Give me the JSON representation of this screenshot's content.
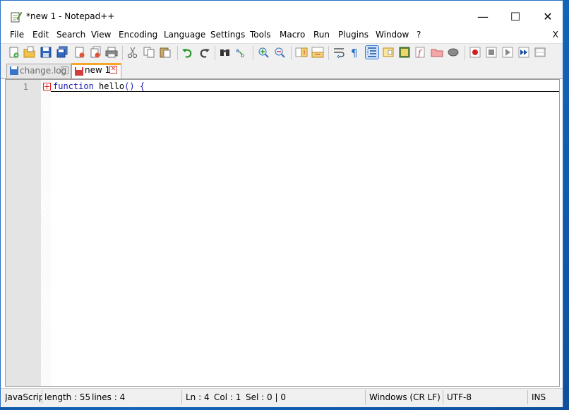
{
  "window": {
    "title": "*new 1 - Notepad++"
  },
  "window_buttons": {
    "minimize": "—",
    "maximize": "☐",
    "close": "✕"
  },
  "menu": {
    "items": [
      "File",
      "Edit",
      "Search",
      "View",
      "Encoding",
      "Language",
      "Settings",
      "Tools",
      "Macro",
      "Run",
      "Plugins",
      "Window",
      "?"
    ],
    "close_doc": "X"
  },
  "toolbar": {
    "icons": [
      "new-file-icon",
      "open-file-icon",
      "save-icon",
      "save-all-icon",
      "close-icon",
      "close-all-icon",
      "print-icon",
      "cut-icon",
      "copy-icon",
      "paste-icon",
      "undo-icon",
      "redo-icon",
      "find-icon",
      "replace-icon",
      "zoom-in-icon",
      "zoom-out-icon",
      "sync-vertical-icon",
      "sync-horizontal-icon",
      "word-wrap-icon",
      "show-all-chars-icon",
      "indent-guide-icon",
      "document-map-icon",
      "function-list-icon",
      "folder-workspace-icon",
      "monitoring-icon",
      "record-macro-icon",
      "stop-macro-icon",
      "play-macro-icon",
      "run-macro-multiple-icon",
      "save-macro-icon"
    ]
  },
  "tabs": [
    {
      "label": "change.log",
      "active": false
    },
    {
      "label": "new 1",
      "active": true
    }
  ],
  "editor": {
    "line_number": "1",
    "code": {
      "keyword": "function",
      "name": "hello",
      "rest": "()",
      "brace": "{"
    }
  },
  "status": {
    "language": "JavaScript",
    "length": "length : 55",
    "lines": "lines : 4",
    "ln": "Ln : 4",
    "col": "Col : 1",
    "sel": "Sel : 0 | 0",
    "eol": "Windows (CR LF)",
    "encoding": "UTF-8",
    "mode": "INS"
  },
  "colors": {
    "accent_tab": "#f7a52b",
    "keyword": "#1b1bb5",
    "fold_marker": "#e02020"
  }
}
